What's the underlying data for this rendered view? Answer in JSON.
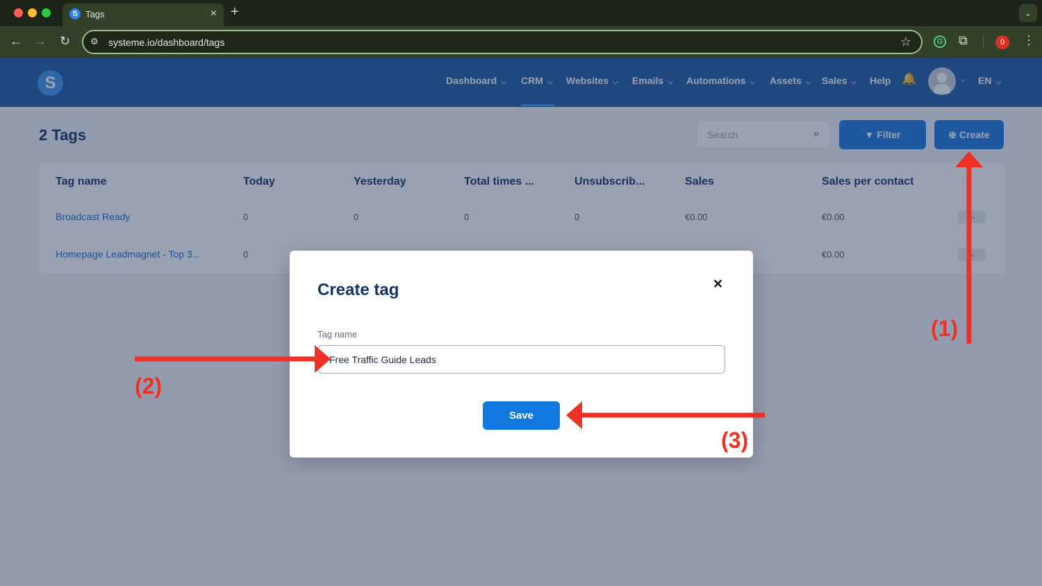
{
  "browser": {
    "tab_title": "Tags",
    "tab_favicon": "S",
    "url": "systeme.io/dashboard/tags",
    "extension_badge": "0"
  },
  "app": {
    "logo_letter": "S",
    "nav": [
      {
        "label": "Dashboard",
        "dropdown": true
      },
      {
        "label": "CRM",
        "dropdown": true,
        "active": true
      },
      {
        "label": "Websites",
        "dropdown": true
      },
      {
        "label": "Emails",
        "dropdown": true
      },
      {
        "label": "Automations",
        "dropdown": true
      },
      {
        "label": "Assets",
        "dropdown": true
      },
      {
        "label": "Sales",
        "dropdown": true
      },
      {
        "label": "Help",
        "dropdown": false
      }
    ],
    "language": "EN"
  },
  "page": {
    "title": "2 Tags",
    "search_placeholder": "Search",
    "filter_label": "Filter",
    "create_label": "Create"
  },
  "table": {
    "columns": [
      "Tag name",
      "Today",
      "Yesterday",
      "Total times ...",
      "Unsubscrib...",
      "Sales",
      "Sales per contact"
    ],
    "rows": [
      {
        "name": "Broadcast Ready",
        "today": "0",
        "yesterday": "0",
        "total": "0",
        "unsub": "0",
        "sales": "€0.00",
        "per_contact": "€0.00"
      },
      {
        "name": "Homepage Leadmagnet - Top 3...",
        "today": "0",
        "yesterday": "",
        "total": "",
        "unsub": "",
        "sales": "",
        "per_contact": "€0.00"
      }
    ],
    "row_actions_label": "..."
  },
  "modal": {
    "title": "Create tag",
    "field_label": "Tag name",
    "field_value": "Free Traffic Guide Leads",
    "save_label": "Save"
  },
  "annotations": {
    "step1": "(1)",
    "step2": "(2)",
    "step3": "(3)",
    "color": "#ee3124"
  }
}
